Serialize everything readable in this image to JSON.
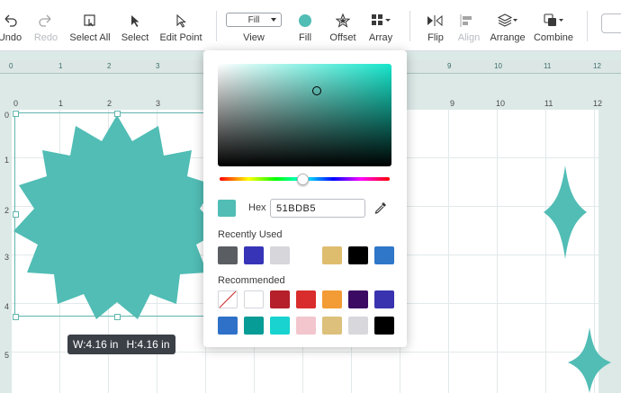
{
  "toolbar": {
    "undo": "Undo",
    "redo": "Redo",
    "select_all": "Select All",
    "select": "Select",
    "edit_point": "Edit Point",
    "fill_value": "Fill",
    "view": "View",
    "fill": "Fill",
    "offset": "Offset",
    "array": "Array",
    "flip": "Flip",
    "align": "Align",
    "arrange": "Arrange",
    "combine": "Combine"
  },
  "ruler": {
    "top": [
      "0",
      "1",
      "2",
      "3",
      "9",
      "10",
      "11",
      "12"
    ]
  },
  "canvas": {
    "top_numbers": [
      "0",
      "1",
      "2",
      "3",
      "9",
      "10",
      "11",
      "12"
    ],
    "side_numbers": [
      "0",
      "1",
      "2",
      "3",
      "4",
      "5"
    ],
    "shape_color": "#51BDB5",
    "dimension_width": "W:4.16 in",
    "dimension_height": "H:4.16 in"
  },
  "color_picker": {
    "hex_label": "Hex",
    "hex_value": "51BDB5",
    "current_color": "#51BDB5",
    "recently_used_title": "Recently Used",
    "recently_used": [
      "#5a5d62",
      "#3734b8",
      "#d6d6db",
      "#ffffff",
      "#dfbd6f",
      "#000000",
      "#2f77c9"
    ],
    "recommended_title": "Recommended",
    "recommended_row1": [
      "none",
      "#ffffff",
      "#b5202a",
      "#d92d2d",
      "#f39b34",
      "#3b0a63",
      "#3a33b0"
    ],
    "recommended_row2": [
      "#2f71c8",
      "#079c95",
      "#18d3cf",
      "#f2c6cc",
      "#dcc07c",
      "#d7d7dc",
      "#000000"
    ]
  }
}
